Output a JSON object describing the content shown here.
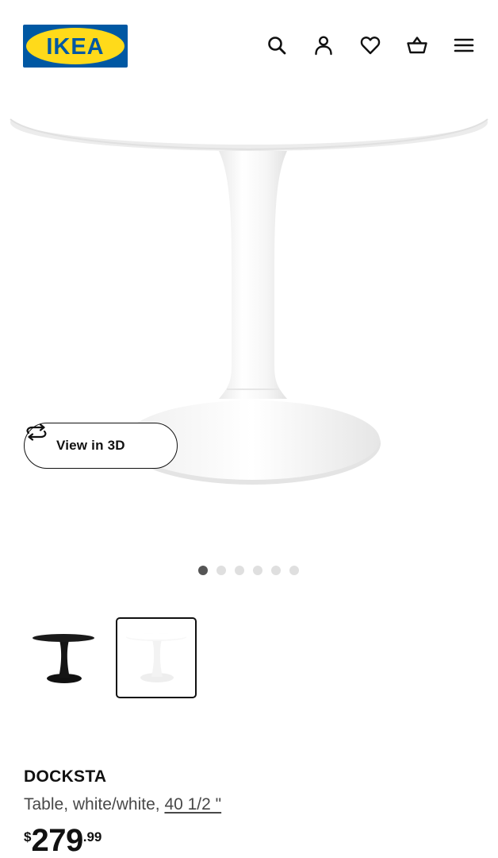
{
  "header": {
    "logo_text": "IKEA",
    "icons": [
      "search-icon",
      "account-icon",
      "heart-icon",
      "cart-icon",
      "menu-icon"
    ]
  },
  "gallery": {
    "view_in_3d_label": "View in 3D",
    "slide_count": 6,
    "active_slide": 1,
    "variants": [
      {
        "name": "black",
        "selected": false
      },
      {
        "name": "white",
        "selected": true
      }
    ]
  },
  "product": {
    "name": "DOCKSTA",
    "description_prefix": "Table, white/white, ",
    "size": "40 1/2 \"",
    "price": {
      "currency": "$",
      "integer": "279",
      "decimal": ".99"
    }
  },
  "colors": {
    "brand_blue": "#0058a3",
    "brand_yellow": "#ffda1a",
    "text": "#111111"
  }
}
